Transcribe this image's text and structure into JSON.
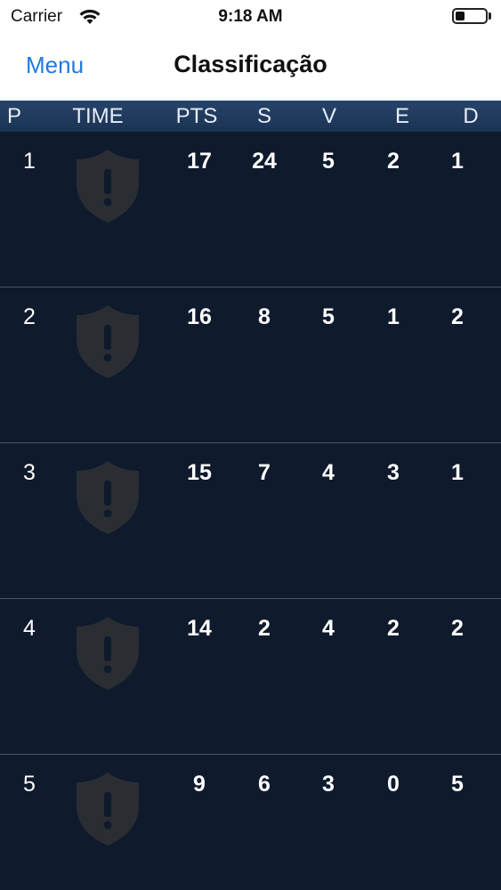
{
  "status_bar": {
    "carrier": "Carrier",
    "time": "9:18 AM",
    "battery_level": 0.3
  },
  "nav": {
    "menu_label": "Menu",
    "title": "Classificação"
  },
  "table": {
    "headers": {
      "pos": "P",
      "team": "TIME",
      "pts": "PTS",
      "s": "S",
      "v": "V",
      "e": "E",
      "d": "D"
    },
    "rows": [
      {
        "pos": "1",
        "team_icon": "shield-alert-icon",
        "pts": "17",
        "s": "24",
        "v": "5",
        "e": "2",
        "d": "1"
      },
      {
        "pos": "2",
        "team_icon": "shield-alert-icon",
        "pts": "16",
        "s": "8",
        "v": "5",
        "e": "1",
        "d": "2"
      },
      {
        "pos": "3",
        "team_icon": "shield-alert-icon",
        "pts": "15",
        "s": "7",
        "v": "4",
        "e": "3",
        "d": "1"
      },
      {
        "pos": "4",
        "team_icon": "shield-alert-icon",
        "pts": "14",
        "s": "2",
        "v": "4",
        "e": "2",
        "d": "2"
      },
      {
        "pos": "5",
        "team_icon": "shield-alert-icon",
        "pts": "9",
        "s": "6",
        "v": "3",
        "e": "0",
        "d": "5"
      }
    ]
  },
  "colors": {
    "accent": "#1e7ae6",
    "background": "#0f1a2c",
    "header": "#1f3a5c",
    "placeholder_shield": "#2a2e33"
  }
}
